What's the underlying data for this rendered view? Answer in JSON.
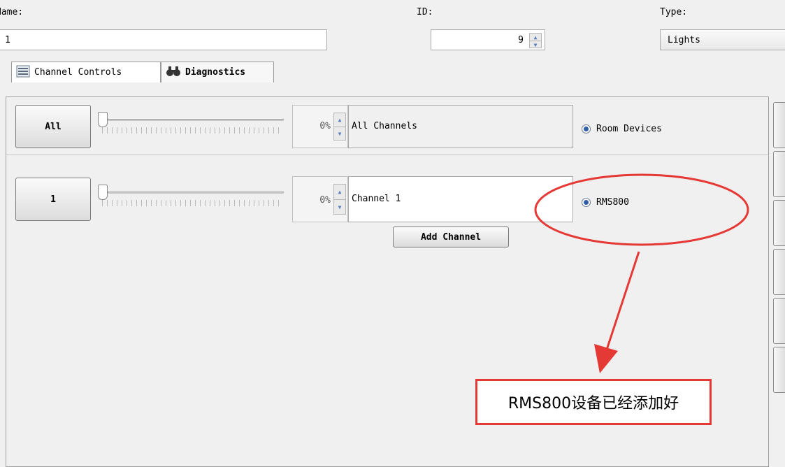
{
  "header": {
    "name_label": "Name:",
    "name_value": "1",
    "id_label": "ID:",
    "id_value": "9",
    "type_label": "Type:",
    "type_value": "Lights"
  },
  "tabs": [
    {
      "label": "Channel Controls",
      "icon": "channel-controls-icon"
    },
    {
      "label": "Diagnostics",
      "icon": "binoculars-icon"
    }
  ],
  "all_row": {
    "button": "All",
    "percent": "0%",
    "name": "All Channels",
    "radio_label": "Room Devices",
    "level": 0
  },
  "channel_row": {
    "button": "1",
    "percent": "0%",
    "name": "Channel 1",
    "radio_label": "RMS800",
    "level": 0
  },
  "add_channel_label": "Add Channel",
  "annotation": {
    "text": "RMS800设备已经添加好",
    "color": "#e53935"
  }
}
